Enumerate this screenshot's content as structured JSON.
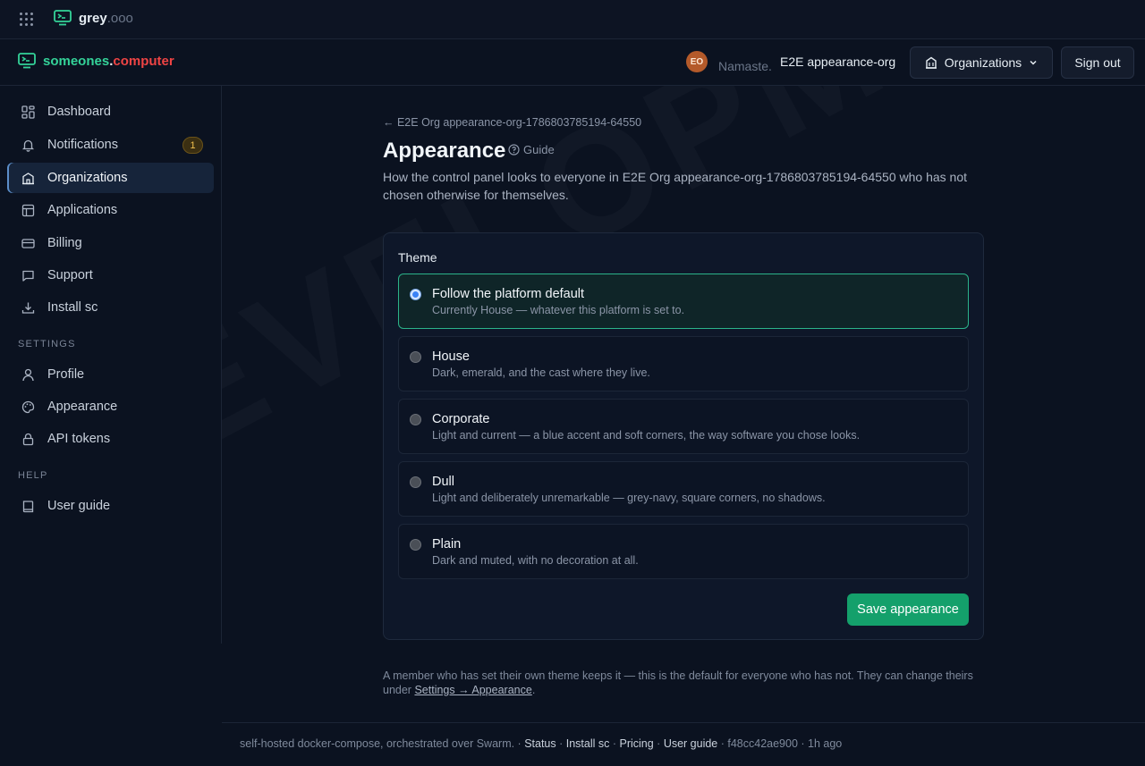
{
  "platform": {
    "brand_name": "grey",
    "brand_tld": ".ooo"
  },
  "header": {
    "brand_name": "someones",
    "brand_dot": ".",
    "brand_tld": "computer",
    "avatar_initials": "EO",
    "greeting": "Namaste.",
    "org_name": "E2E appearance-org",
    "organizations_label": "Organizations",
    "signout_label": "Sign out"
  },
  "sidebar": {
    "items": [
      {
        "label": "Dashboard",
        "icon": "dashboard-icon"
      },
      {
        "label": "Notifications",
        "icon": "bell-icon",
        "badge": "1"
      },
      {
        "label": "Organizations",
        "icon": "building-icon"
      },
      {
        "label": "Applications",
        "icon": "layout-icon"
      },
      {
        "label": "Billing",
        "icon": "credit-card-icon"
      },
      {
        "label": "Support",
        "icon": "chat-icon"
      },
      {
        "label": "Install sc",
        "icon": "download-icon"
      }
    ],
    "settings_label": "SETTINGS",
    "settings_items": [
      {
        "label": "Profile",
        "icon": "user-icon"
      },
      {
        "label": "Appearance",
        "icon": "palette-icon"
      },
      {
        "label": "API tokens",
        "icon": "lock-icon"
      }
    ],
    "help_label": "HELP",
    "help_items": [
      {
        "label": "User guide",
        "icon": "book-icon"
      }
    ]
  },
  "main": {
    "back_link": "← E2E Org appearance-org-1786803785194-64550",
    "title": "Appearance",
    "guide_label": "Guide",
    "description": "How the control panel looks to everyone in E2E Org appearance-org-1786803785194-64550 who has not chosen otherwise for themselves.",
    "theme_label": "Theme",
    "options": [
      {
        "title": "Follow the platform default",
        "desc": "Currently House — whatever this platform is set to.",
        "selected": true
      },
      {
        "title": "House",
        "desc": "Dark, emerald, and the cast where they live.",
        "selected": false
      },
      {
        "title": "Corporate",
        "desc": "Light and current — a blue accent and soft corners, the way software you chose looks.",
        "selected": false
      },
      {
        "title": "Dull",
        "desc": "Light and deliberately unremarkable — grey-navy, square corners, no shadows.",
        "selected": false
      },
      {
        "title": "Plain",
        "desc": "Dark and muted, with no decoration at all.",
        "selected": false
      }
    ],
    "save_label": "Save appearance",
    "footnote_text": "A member who has set their own theme keeps it — this is the default for everyone who has not. They can change theirs under",
    "footnote_link": "Settings → Appearance",
    "footnote_end": ".",
    "watermark": "DEVELOPMENT"
  },
  "footer": {
    "text": "self-hosted docker-compose, orchestrated over Swarm.",
    "sep": " · ",
    "links": [
      "Status",
      "Install sc",
      "Pricing",
      "User guide"
    ],
    "commit": "f48cc42ae900",
    "age": "1h ago"
  },
  "colors": {
    "accent": "#34d399",
    "save_button": "#14a06b",
    "selected_border": "#2bb38a",
    "brand_tld": "#ef4444"
  }
}
